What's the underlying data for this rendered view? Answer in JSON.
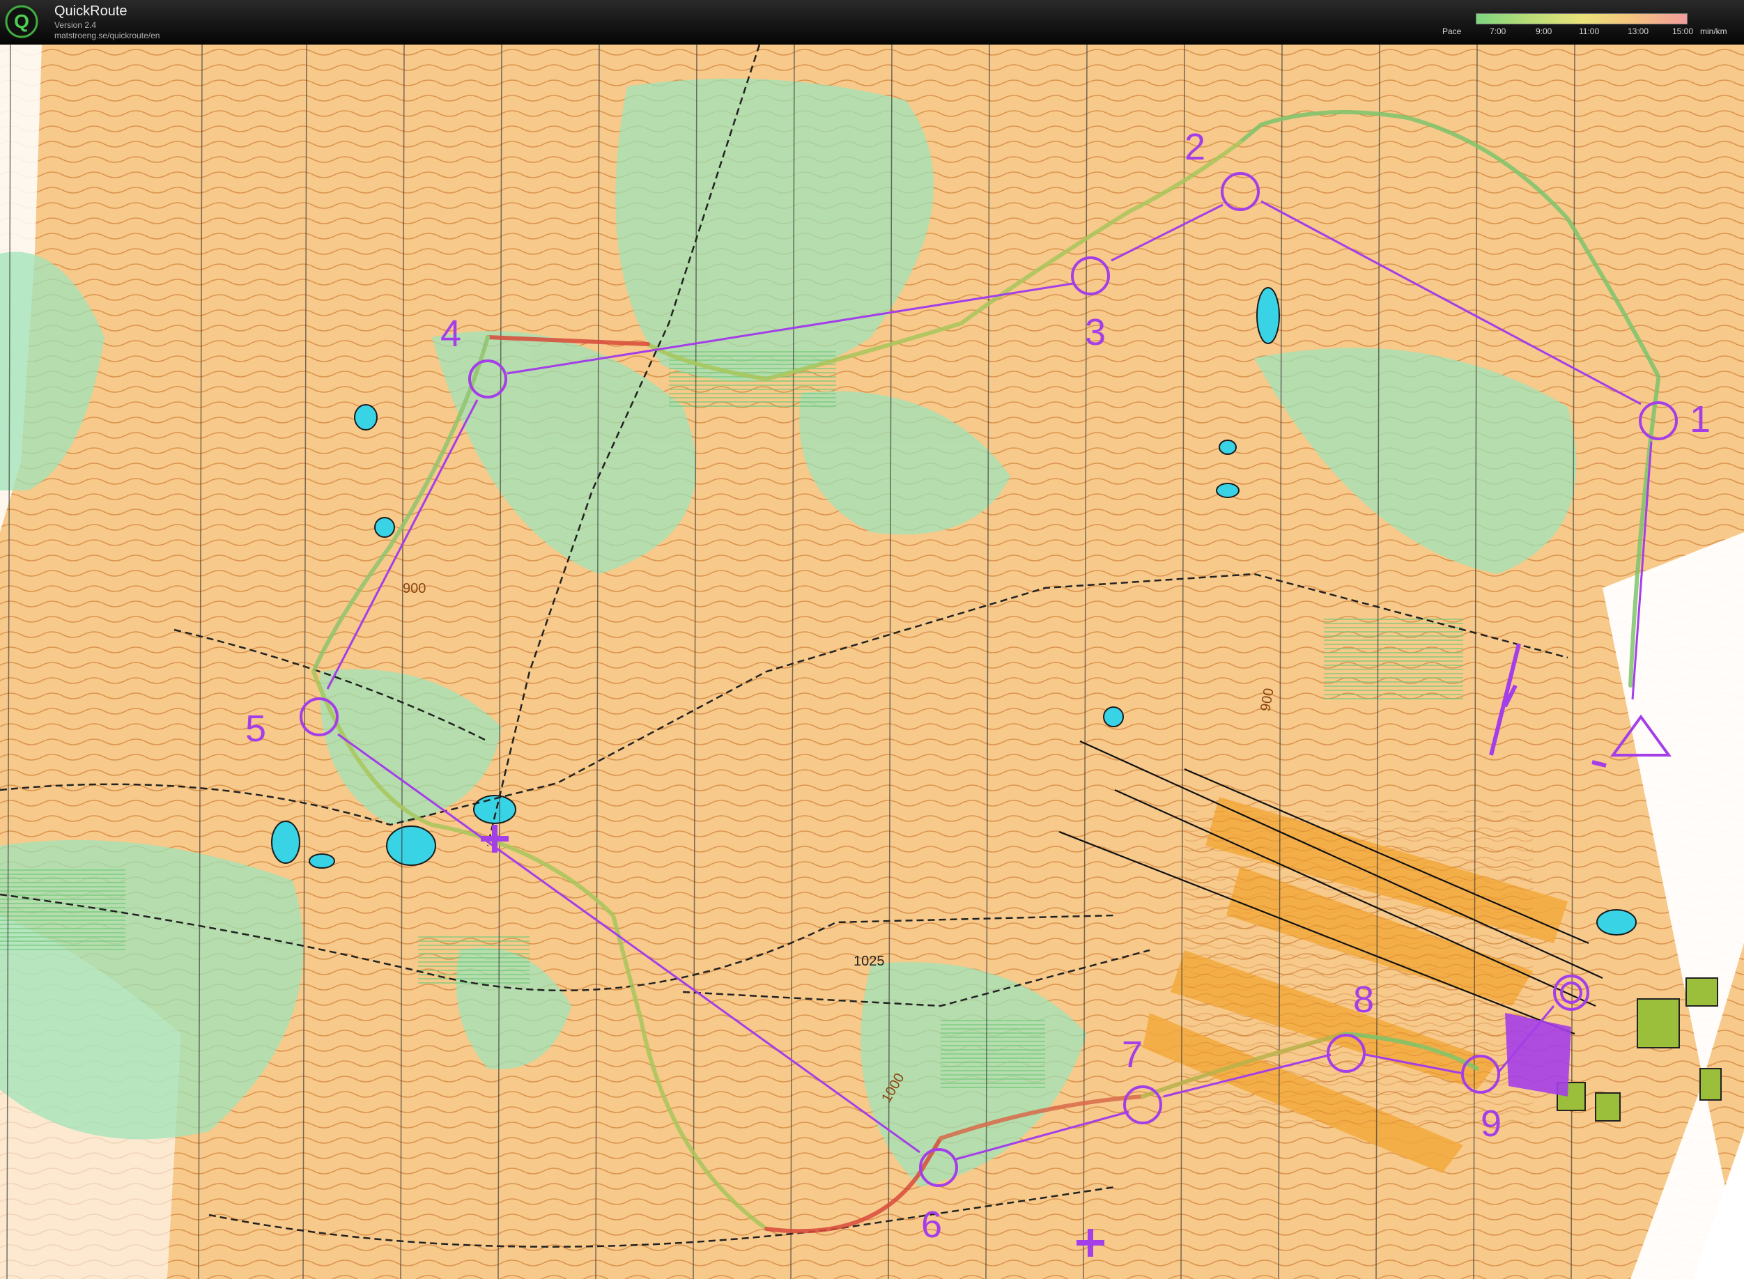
{
  "app": {
    "title": "QuickRoute",
    "version": "Version 2.4",
    "url": "matstroeng.se/quickroute/en"
  },
  "pace_legend": {
    "label": "Pace",
    "ticks": [
      "7:00",
      "9:00",
      "11:00",
      "13:00",
      "15:00"
    ],
    "unit": "min/km"
  },
  "map": {
    "contour_labels": [
      "900",
      "900",
      "1000",
      "1025"
    ],
    "controls": [
      {
        "number": "1"
      },
      {
        "number": "2"
      },
      {
        "number": "3"
      },
      {
        "number": "4"
      },
      {
        "number": "5"
      },
      {
        "number": "6"
      },
      {
        "number": "7"
      },
      {
        "number": "8"
      },
      {
        "number": "9"
      }
    ]
  },
  "colors": {
    "course": "#a43ee8",
    "terrain": "#f7c98a",
    "vegetation": "#9fe3b8",
    "water": "#39d3e6",
    "contour": "#c46a1e",
    "route_slow": "#d84a3a",
    "route_fast": "#7cc46b"
  }
}
